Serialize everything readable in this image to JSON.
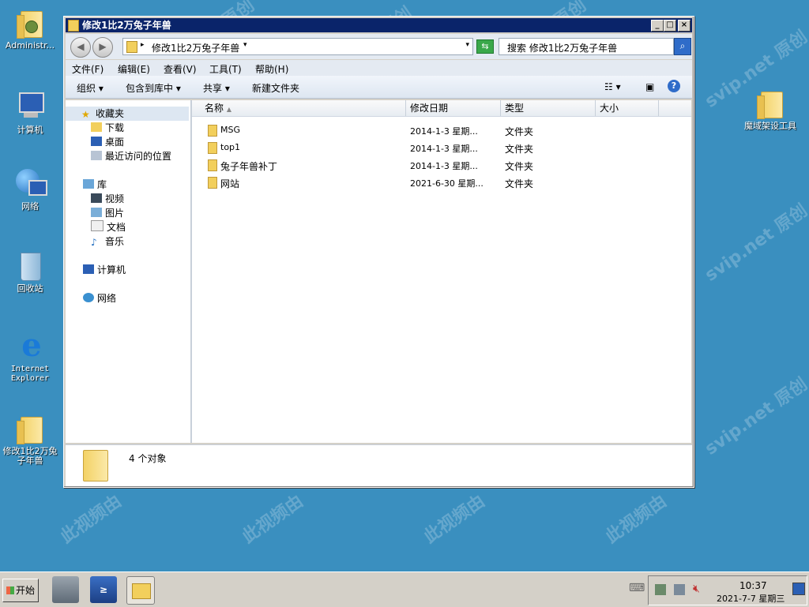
{
  "desktop": {
    "icons": [
      {
        "label": "Administr..."
      },
      {
        "label": "计算机"
      },
      {
        "label": "网络"
      },
      {
        "label": "回收站"
      },
      {
        "label": "Internet Explorer"
      },
      {
        "label": "修改1比2万兔子年兽"
      },
      {
        "label": "魔域架设工具"
      }
    ],
    "watermark": "svip.net 原创"
  },
  "window": {
    "title": "修改1比2万兔子年兽",
    "address_path": "修改1比2万兔子年兽",
    "search_placeholder": "搜索 修改1比2万兔子年兽",
    "menu": [
      "文件(F)",
      "编辑(E)",
      "查看(V)",
      "工具(T)",
      "帮助(H)"
    ],
    "toolbar": [
      "组织 ▾",
      "包含到库中 ▾",
      "共享 ▾",
      "新建文件夹"
    ],
    "nav": {
      "favorites": "收藏夹",
      "favorites_items": [
        "下载",
        "桌面",
        "最近访问的位置"
      ],
      "libraries": "库",
      "libraries_items": [
        "视频",
        "图片",
        "文档",
        "音乐"
      ],
      "computer": "计算机",
      "network": "网络"
    },
    "columns": [
      "名称",
      "修改日期",
      "类型",
      "大小"
    ],
    "rows": [
      {
        "name": "MSG",
        "date": "2014-1-3 星期...",
        "type": "文件夹"
      },
      {
        "name": "top1",
        "date": "2014-1-3 星期...",
        "type": "文件夹"
      },
      {
        "name": "兔子年兽补丁",
        "date": "2014-1-3 星期...",
        "type": "文件夹"
      },
      {
        "name": "网站",
        "date": "2021-6-30 星期...",
        "type": "文件夹"
      }
    ],
    "status": "4 个对象"
  },
  "taskbar": {
    "start_label": "开始",
    "time": "10:37",
    "date": "2021-7-7 星期三"
  }
}
